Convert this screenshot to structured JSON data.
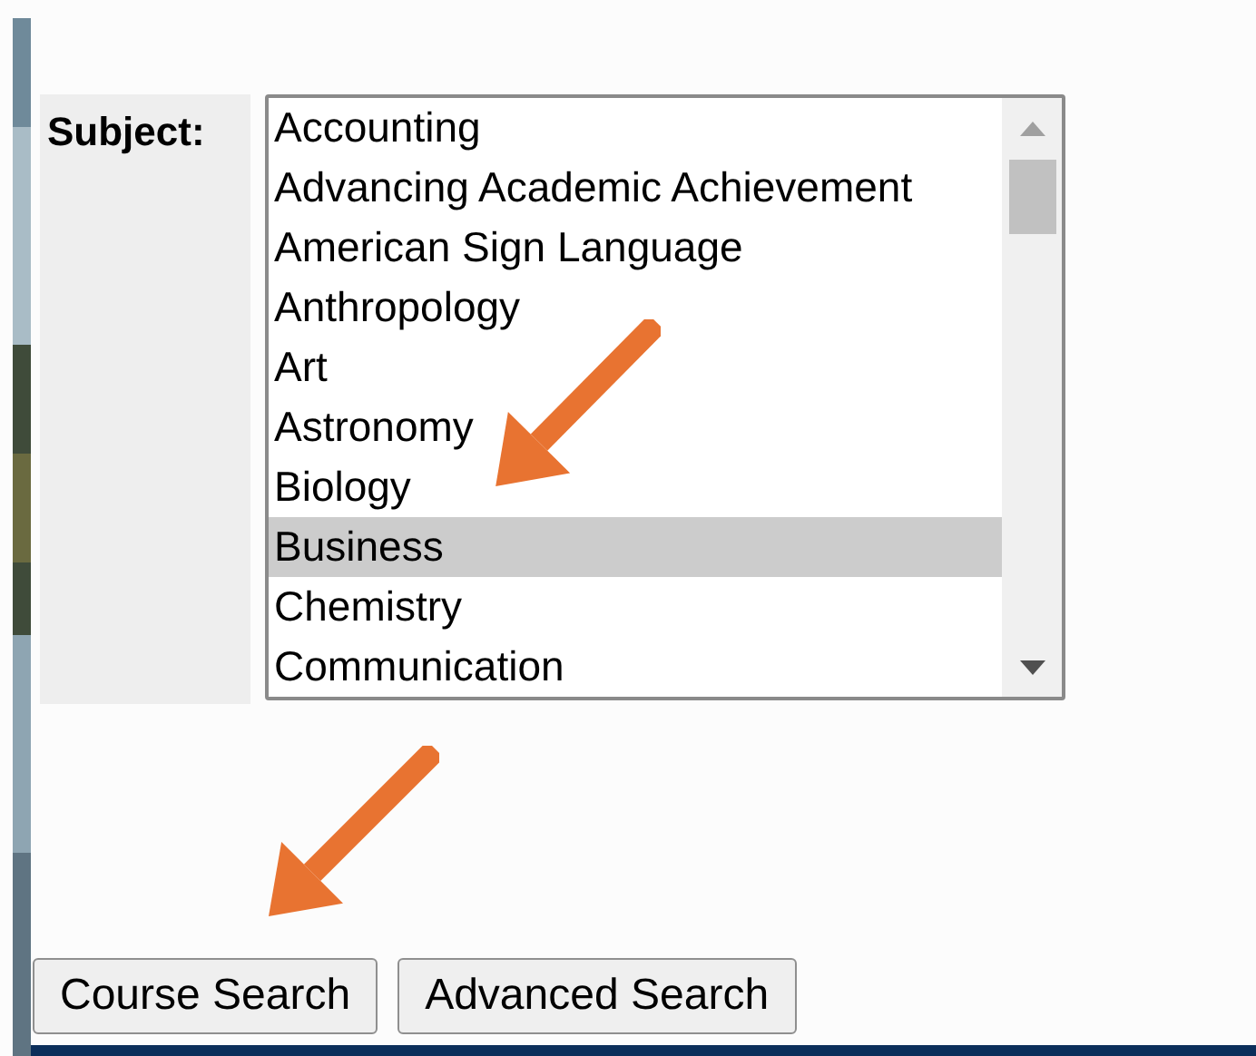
{
  "subject_field": {
    "label": "Subject:",
    "options": [
      {
        "label": "Accounting",
        "selected": false
      },
      {
        "label": "Advancing Academic Achievement",
        "selected": false
      },
      {
        "label": "American Sign Language",
        "selected": false
      },
      {
        "label": "Anthropology",
        "selected": false
      },
      {
        "label": "Art",
        "selected": false
      },
      {
        "label": "Astronomy",
        "selected": false
      },
      {
        "label": "Biology",
        "selected": false
      },
      {
        "label": "Business",
        "selected": true
      },
      {
        "label": "Chemistry",
        "selected": false
      },
      {
        "label": "Communication",
        "selected": false
      }
    ]
  },
  "buttons": [
    {
      "label": "Course Search"
    },
    {
      "label": "Advanced Search"
    }
  ]
}
